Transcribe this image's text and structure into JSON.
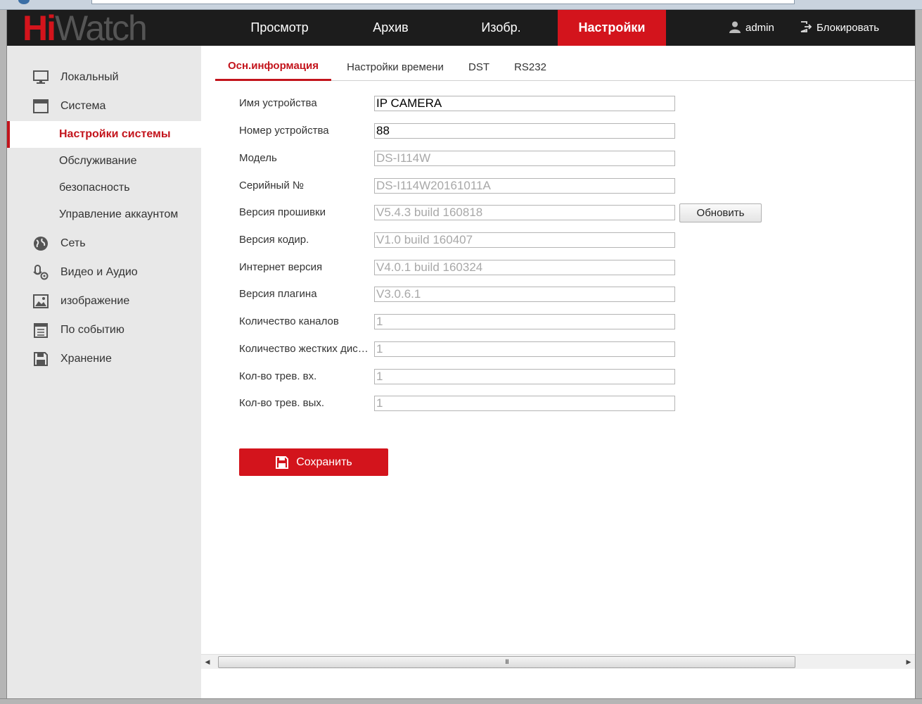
{
  "header": {
    "logo_hi": "Hi",
    "logo_watch": "Watch",
    "nav": [
      {
        "label": "Просмотр"
      },
      {
        "label": "Архив"
      },
      {
        "label": "Изобр."
      },
      {
        "label": "Настройки",
        "active": true
      }
    ],
    "user": "admin",
    "logout": "Блокировать"
  },
  "sidebar": {
    "items": [
      {
        "label": "Локальный",
        "icon": "monitor-icon"
      },
      {
        "label": "Система",
        "icon": "window-icon"
      },
      {
        "label": "Настройки системы",
        "sub": true,
        "active": true
      },
      {
        "label": "Обслуживание",
        "sub": true
      },
      {
        "label": "безопасность",
        "sub": true
      },
      {
        "label": "Управление аккаунтом",
        "sub": true
      },
      {
        "label": "Сеть",
        "icon": "globe-icon"
      },
      {
        "label": "Видео и Аудио",
        "icon": "microphone-icon"
      },
      {
        "label": "изображение",
        "icon": "image-icon"
      },
      {
        "label": "По событию",
        "icon": "calendar-icon"
      },
      {
        "label": "Хранение",
        "icon": "floppy-icon"
      }
    ]
  },
  "tabs": [
    {
      "label": "Осн.информация",
      "active": true
    },
    {
      "label": "Настройки времени"
    },
    {
      "label": "DST"
    },
    {
      "label": "RS232"
    }
  ],
  "form": {
    "fields": [
      {
        "label": "Имя устройства",
        "value": "IP CAMERA",
        "readonly": false
      },
      {
        "label": "Номер устройства",
        "value": "88",
        "readonly": false
      },
      {
        "label": "Модель",
        "value": "DS-I114W",
        "readonly": true
      },
      {
        "label": "Серийный №",
        "value": "DS-I114W20161011A",
        "readonly": true
      },
      {
        "label": "Версия прошивки",
        "value": "V5.4.3 build 160818",
        "readonly": true
      },
      {
        "label": "Версия кодир.",
        "value": "V1.0 build 160407",
        "readonly": true
      },
      {
        "label": "Интернет версия",
        "value": "V4.0.1 build 160324",
        "readonly": true
      },
      {
        "label": "Версия плагина",
        "value": "V3.0.6.1",
        "readonly": true
      },
      {
        "label": "Количество каналов",
        "value": "1",
        "readonly": true
      },
      {
        "label": "Количество жестких дис…",
        "value": "1",
        "readonly": true
      },
      {
        "label": "Кол-во трев. вх.",
        "value": "1",
        "readonly": true
      },
      {
        "label": "Кол-во трев. вых.",
        "value": "1",
        "readonly": true
      }
    ],
    "update_button": "Обновить",
    "save_button": "Сохранить"
  },
  "scrollbar": {
    "grip": "III"
  },
  "colors": {
    "accent": "#d3141c",
    "header_bg": "#1c1c1c",
    "sidebar_bg": "#e8e8e8"
  }
}
